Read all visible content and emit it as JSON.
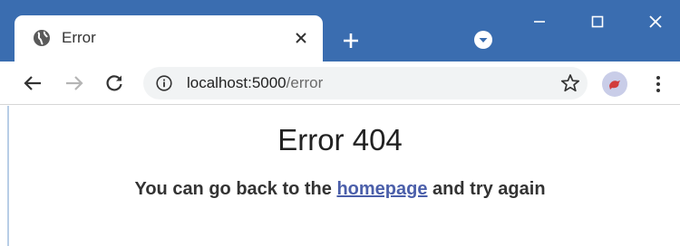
{
  "browser": {
    "tab": {
      "title": "Error"
    },
    "address_bar": {
      "host": "localhost:5000",
      "path": "/error"
    },
    "icons": {
      "favicon": "globe-icon",
      "tab_close": "close-icon",
      "new_tab": "plus-icon",
      "tab_search": "chevron-down-icon",
      "back": "arrow-left-icon",
      "forward": "arrow-right-icon",
      "reload": "reload-icon",
      "site_info": "info-icon",
      "bookmark": "star-icon",
      "profile": "avatar",
      "menu": "kebab-menu-icon",
      "minimize": "minimize-icon",
      "maximize": "maximize-icon",
      "close_window": "close-icon"
    },
    "colors": {
      "frame": "#3a6db0",
      "link": "#4b5faa"
    }
  },
  "page": {
    "heading": "Error 404",
    "message_before": "You can go back to the ",
    "link_text": "homepage",
    "message_after": " and try again"
  }
}
